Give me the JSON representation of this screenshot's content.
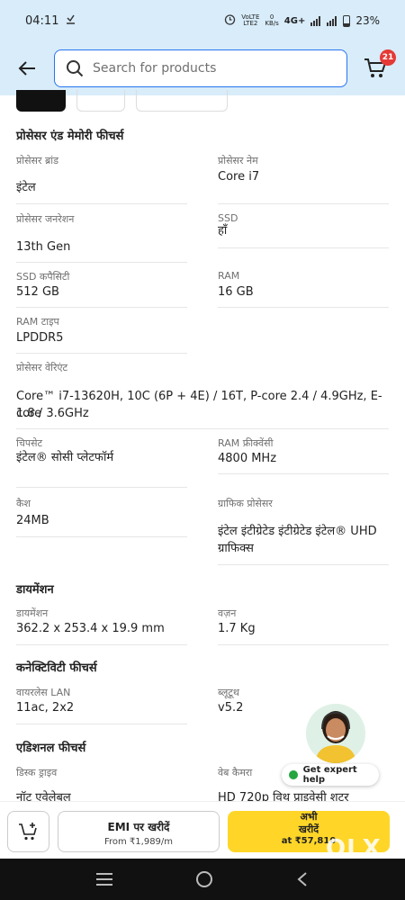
{
  "status_bar": {
    "time": "04:11",
    "network_top": "VoLTE",
    "network_bottom": "LTE2",
    "speed_top": "0",
    "speed_bottom": "KB/s",
    "network_type": "4G+",
    "battery": "23%"
  },
  "header": {
    "search_placeholder": "Search for products",
    "cart_count": "21"
  },
  "sections": {
    "processor": {
      "title": "प्रोसेसर एंड मेमोरी फीचर्स",
      "brand_label": "प्रोसेसर ब्रांड",
      "brand_value": "इंटेल",
      "name_label": "प्रोसेसर नेम",
      "name_value": "Core i7",
      "generation_label": "प्रोसेसर जनरेशन",
      "generation_value": "13th Gen",
      "ssd_label": "SSD",
      "ssd_value": "हाँ",
      "ssd_capacity_label": "SSD कपैसिटी",
      "ssd_capacity_value": "512 GB",
      "ram_label": "RAM",
      "ram_value": "16 GB",
      "ram_type_label": "RAM टाइप",
      "ram_type_value": "LPDDR5",
      "variant_label": "प्रोसेसर वेरिएंट",
      "variant_value_line1": "Core™ i7-13620H, 10C (6P + 4E) / 16T, P-core 2.4 / 4.9GHz, E-core",
      "variant_value_line2": "1.8 / 3.6GHz",
      "chipset_label": "चिपसेट",
      "chipset_value": "इंटेल® सोसी प्लेटफॉर्म",
      "ram_freq_label": "RAM फ्रीक्वेंसी",
      "ram_freq_value": "4800 MHz",
      "cache_label": "कैश",
      "cache_value": "24MB",
      "graphics_label": "ग्राफिक प्रोसेसर",
      "graphics_value_line1": "इंटेल इंटीग्रेटेड इंटीग्रेटेड इंटेल® UHD",
      "graphics_value_line2": "ग्राफिक्स"
    },
    "dimension": {
      "title": "डायमेंशन",
      "dimension_label": "डायमेंशन",
      "dimension_value": "362.2 x 253.4 x 19.9 mm",
      "weight_label": "वज़न",
      "weight_value": "1.7 Kg"
    },
    "connectivity": {
      "title": "कनेक्टिविटी फीचर्स",
      "wlan_label": "वायरलेस LAN",
      "wlan_value": "11ac, 2x2",
      "bt_label": "ब्लूटूथ",
      "bt_value": "v5.2"
    },
    "additional": {
      "title": "एडिशनल फीचर्स",
      "disk_label": "डिस्क ड्राइव",
      "disk_value": "नॉट एवेलेबल",
      "webcam_label": "वेब कैमरा",
      "webcam_value": "HD 720p विथ प्राइवेसी शटर"
    }
  },
  "expert_help": {
    "label": "Get expert help"
  },
  "bottom_bar": {
    "emi_title": "EMI पर खरीदें",
    "emi_sub": "From ₹1,989/m",
    "buy_line1": "अभी",
    "buy_line2": "खरीदें",
    "buy_price": "at ₹57,810"
  },
  "watermark": "OLX",
  "colors": {
    "header_bg": "#d8ecfa",
    "search_border": "#2874f0",
    "buy_button": "#ffd628",
    "badge": "#e53935",
    "online_dot": "#26a541"
  }
}
